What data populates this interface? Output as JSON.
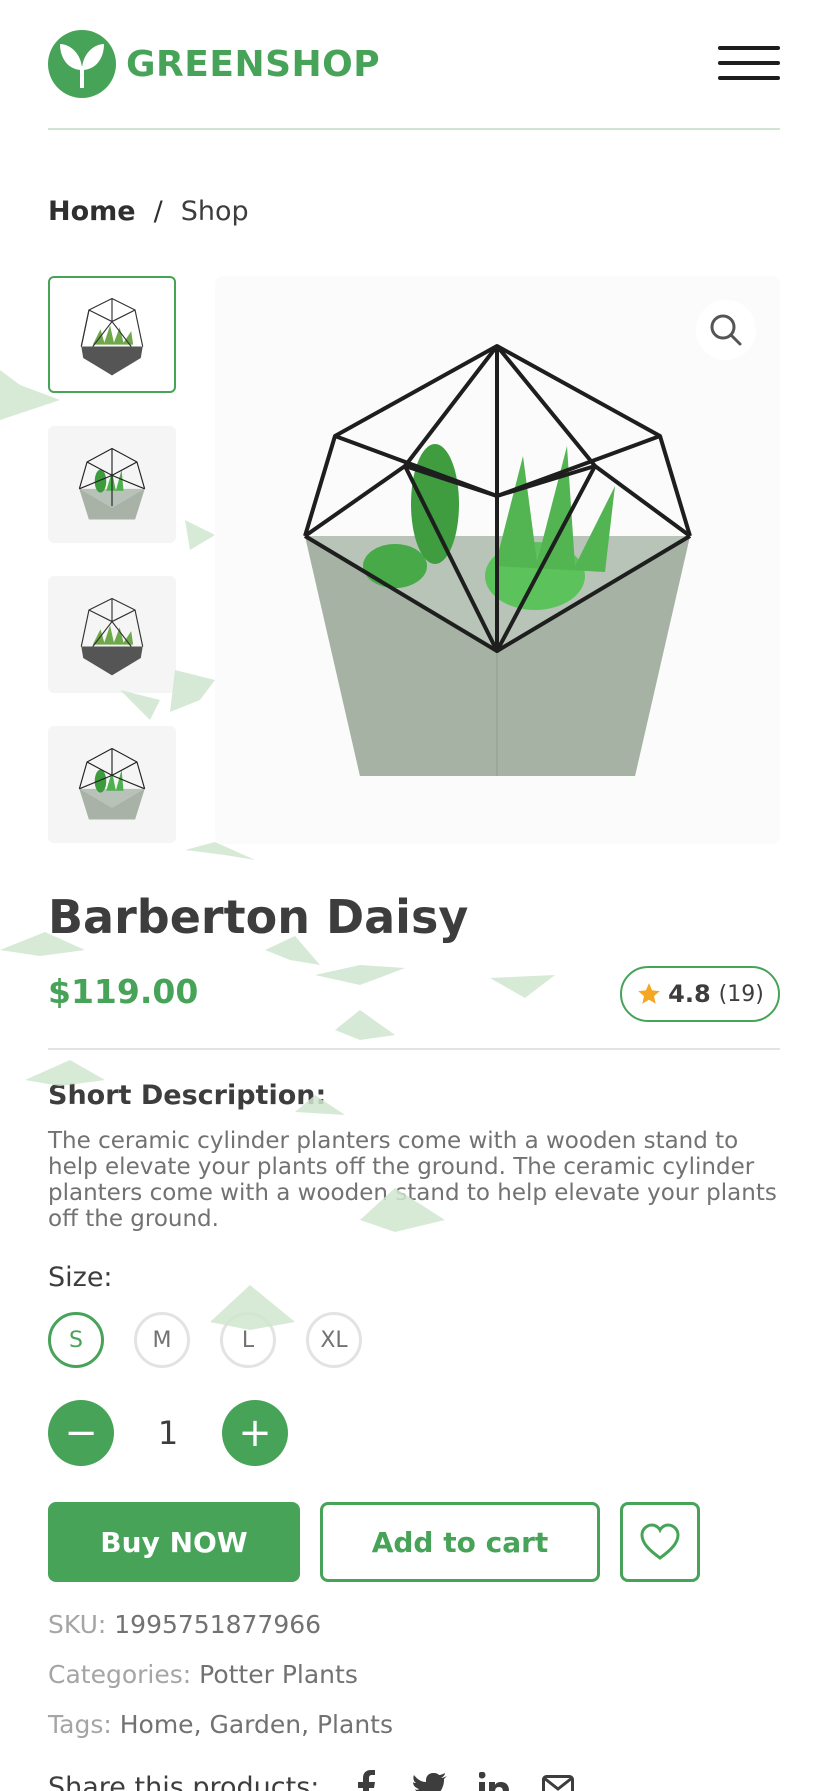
{
  "brand": {
    "name": "GREENSHOP",
    "color": "#46a358"
  },
  "header": {
    "menu_icon": "hamburger-menu-icon"
  },
  "breadcrumb": {
    "home": "Home",
    "separator": "/",
    "current": "Shop"
  },
  "gallery": {
    "thumbnails": [
      "terrarium-dark-pot",
      "terrarium-cactus-grey-pot",
      "terrarium-dark-pot",
      "terrarium-cactus-grey-pot"
    ],
    "active_index": 0,
    "zoom_icon": "search-icon"
  },
  "product": {
    "title": "Barberton Daisy",
    "price": "$119.00",
    "rating": "4.8",
    "reviews": "(19)",
    "short_description_heading": "Short Description:",
    "short_description": "The ceramic cylinder planters come with a wooden stand to help elevate your plants off the ground. The ceramic cylinder planters come with a wooden stand to help elevate your plants off the ground.",
    "size_label": "Size:",
    "sizes": [
      "S",
      "M",
      "L",
      "XL"
    ],
    "selected_size": "S",
    "quantity": "1",
    "minus": "−",
    "plus": "+"
  },
  "actions": {
    "buy": "Buy NOW",
    "cart": "Add to cart",
    "wishlist_icon": "heart-icon"
  },
  "meta": {
    "sku_label": "SKU:",
    "sku": "1995751877966",
    "categories_label": "Categories:",
    "categories": "Potter Plants",
    "tags_label": "Tags:",
    "tags": "Home, Garden, Plants"
  },
  "share": {
    "label": "Share this products:",
    "icons": [
      "facebook-icon",
      "twitter-icon",
      "linkedin-icon",
      "mail-icon"
    ]
  }
}
